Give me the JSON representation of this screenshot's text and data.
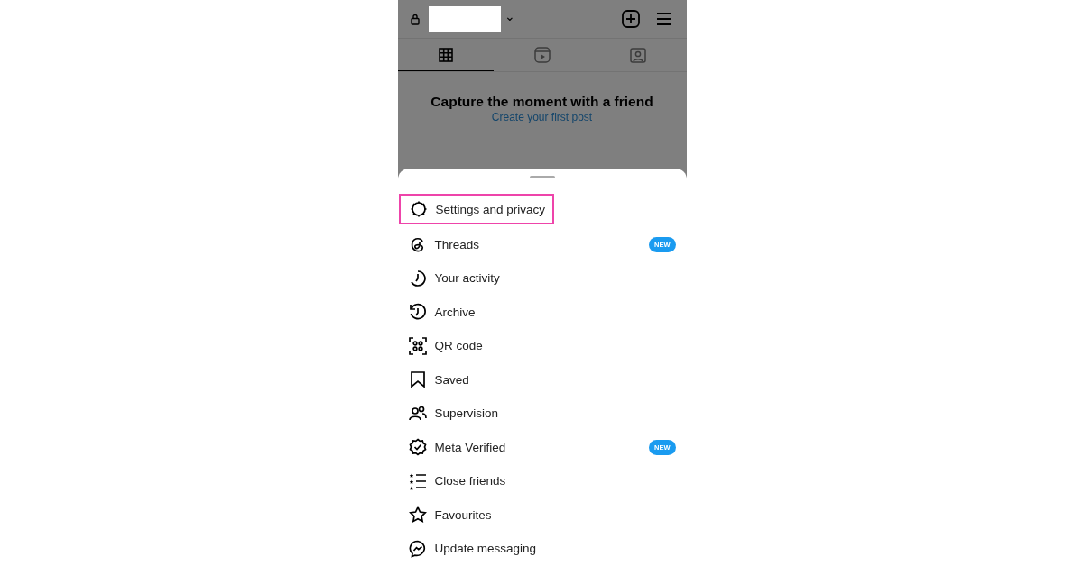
{
  "top_bar": {
    "dropdown_caret": "⌄"
  },
  "tabs": [
    {
      "kind": "grid",
      "selected": true
    },
    {
      "kind": "reels",
      "selected": false
    },
    {
      "kind": "tagged",
      "selected": false
    }
  ],
  "empty_state": {
    "title": "Capture the moment with a friend",
    "link": "Create your first post"
  },
  "menu": [
    {
      "kind": "settings",
      "label": "Settings and privacy",
      "highlighted": true
    },
    {
      "kind": "threads",
      "label": "Threads",
      "highlighted": false,
      "badge": "NEW"
    },
    {
      "kind": "activity",
      "label": "Your activity",
      "highlighted": false
    },
    {
      "kind": "archive",
      "label": "Archive",
      "highlighted": false
    },
    {
      "kind": "qr",
      "label": "QR code",
      "highlighted": false
    },
    {
      "kind": "saved",
      "label": "Saved",
      "highlighted": false
    },
    {
      "kind": "supervision",
      "label": "Supervision",
      "highlighted": false
    },
    {
      "kind": "verified",
      "label": "Meta Verified",
      "highlighted": false,
      "badge": "NEW"
    },
    {
      "kind": "close",
      "label": "Close friends",
      "highlighted": false
    },
    {
      "kind": "star",
      "label": "Favourites",
      "highlighted": false
    },
    {
      "kind": "messenger",
      "label": "Update messaging",
      "highlighted": false
    }
  ]
}
